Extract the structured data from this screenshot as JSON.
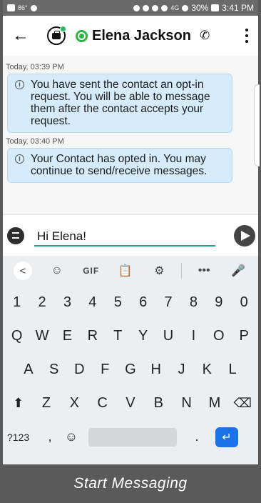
{
  "status_bar": {
    "temperature": "86°",
    "network_label": "4G",
    "battery": "30%",
    "time": "3:41 PM"
  },
  "header": {
    "contact_name": "Elena Jackson",
    "back_icon": "arrow-left-icon",
    "channel_icon": "whatsapp-icon",
    "call_icon": "phone-icon",
    "menu_icon": "more-vert-icon"
  },
  "messages": [
    {
      "timestamp": "Today, 03:39 PM",
      "text": "You have sent the contact an opt-in request. You will be able to message them after the contact accepts your request."
    },
    {
      "timestamp": "Today, 03:40 PM",
      "text": "Your Contact has opted in. You may continue to send/receive messages."
    }
  ],
  "composer": {
    "value": "Hi Elena!"
  },
  "keyboard": {
    "toolbar": [
      "<",
      "☺",
      "GIF",
      "📋",
      "⚙",
      "•••",
      "🎤"
    ],
    "number_row": [
      "1",
      "2",
      "3",
      "4",
      "5",
      "6",
      "7",
      "8",
      "9",
      "0"
    ],
    "row1": [
      "Q",
      "W",
      "E",
      "R",
      "T",
      "Y",
      "U",
      "I",
      "O",
      "P"
    ],
    "row2": [
      "A",
      "S",
      "D",
      "F",
      "G",
      "H",
      "J",
      "K",
      "L"
    ],
    "row3": [
      "Z",
      "X",
      "C",
      "V",
      "B",
      "N",
      "M"
    ],
    "symbols_key": "?123",
    "comma_key": ",",
    "period_key": "."
  },
  "footer": {
    "label": "Start Messaging"
  },
  "colors": {
    "bubble_bg": "#d6ebfb",
    "input_underline": "#2e9e8a",
    "enter_key": "#1a73e8",
    "footer_bg": "#5a5a5a",
    "whatsapp_green": "#2bb741"
  }
}
